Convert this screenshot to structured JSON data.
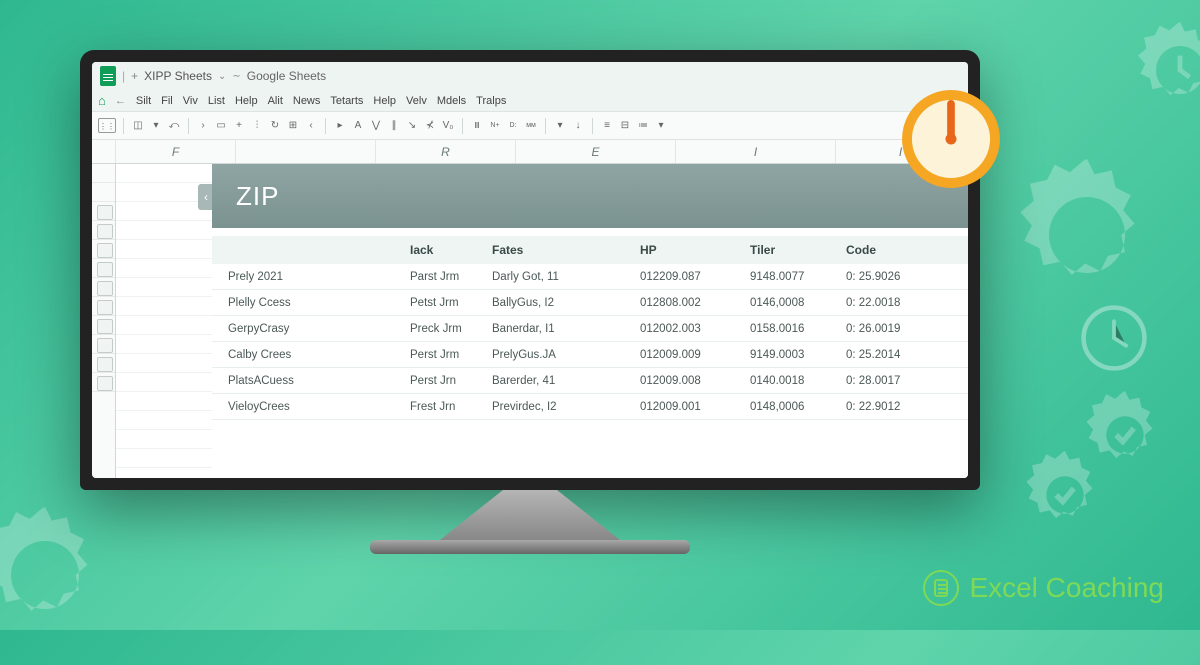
{
  "titlebar": {
    "doc": "XIPP Sheets",
    "app": "Google Sheets"
  },
  "menu": [
    "Silt",
    "Fil",
    "Viv",
    "List",
    "Help",
    "Alit",
    "News",
    "Tetarts",
    "Help",
    "Velv",
    "Mdels",
    "Tralps"
  ],
  "cols": [
    "F",
    "",
    "R",
    "E",
    "I",
    "I"
  ],
  "banner": "ZIP",
  "headers": {
    "c1": "",
    "c2": "Iack",
    "c3": "Fates",
    "c4": "HP",
    "c5": "Tiler",
    "c6": "Code"
  },
  "rows": [
    {
      "a": "Prely 2021",
      "b": "Parst Jrm",
      "c": "Darly Got, 11",
      "d": "012209.087",
      "e": "9148.0077",
      "f": "0: 25.9026"
    },
    {
      "a": "Plelly Ccess",
      "b": "Petst Jrm",
      "c": "BallyGus, I2",
      "d": "012808.002",
      "e": "0146,0008",
      "f": "0: 22.0018"
    },
    {
      "a": "GerpyCrasy",
      "b": "Preck Jrm",
      "c": "Banerdar, I1",
      "d": "012002.003",
      "e": "0158.0016",
      "f": "0: 26.0019"
    },
    {
      "a": "Calby Crees",
      "b": "Perst Jrm",
      "c": "PrelyGus.JA",
      "d": "012009.009",
      "e": "9149.0003",
      "f": "0: 25.2014"
    },
    {
      "a": "PlatsACuess",
      "b": "Perst Jrn",
      "c": "Barerder, 41",
      "d": "012009.008",
      "e": "0140.0018",
      "f": "0: 28.0017"
    },
    {
      "a": "VieloyCrees",
      "b": "Frest Jrn",
      "c": "Previrdec, I2",
      "d": "012009.001",
      "e": "0148,0006",
      "f": "0: 22.9012"
    }
  ],
  "brand": "Excel Coaching",
  "colw": {
    "c0": 98,
    "c1": 90,
    "c2": 82,
    "c3": 148,
    "c4": 110,
    "c5": 96,
    "c6": 110
  }
}
